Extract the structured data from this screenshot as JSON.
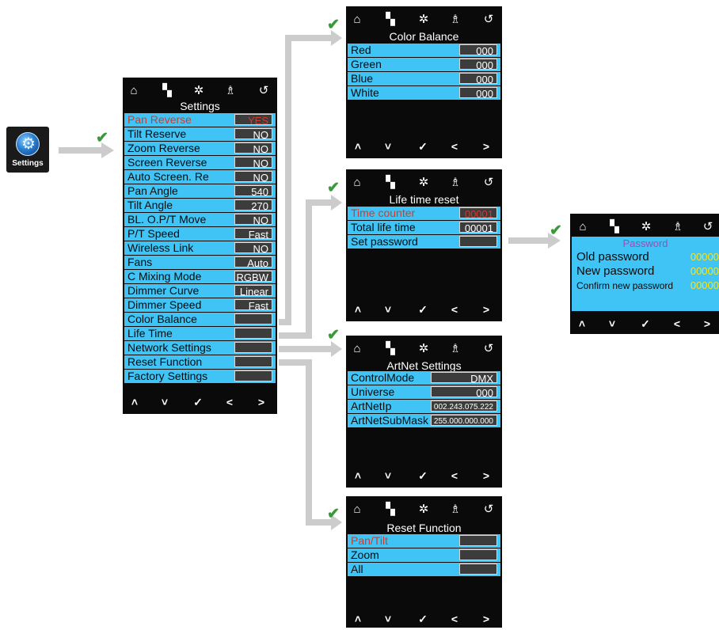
{
  "app_icon": {
    "label": "Settings",
    "icon": "gear-icon"
  },
  "nav_icons": {
    "home": "⌂",
    "mode": "▚",
    "effect": "✲",
    "network": "♗",
    "back": "↺"
  },
  "bottom_icons": {
    "up": "˄",
    "down": "˅",
    "ok": "✓",
    "left": "<",
    "right": ">"
  },
  "check_mark": "✔",
  "settings_panel": {
    "title": "Settings",
    "rows": [
      {
        "label": "Pan Reverse",
        "value": "YES",
        "selected": true
      },
      {
        "label": "Tilt Reserve",
        "value": "NO"
      },
      {
        "label": "Zoom Reverse",
        "value": "NO"
      },
      {
        "label": "Screen Reverse",
        "value": "NO"
      },
      {
        "label": "Auto Screen. Re",
        "value": "NO"
      },
      {
        "label": "Pan Angle",
        "value": "540"
      },
      {
        "label": "Tilt Angle",
        "value": "270"
      },
      {
        "label": "BL. O.P/T Move",
        "value": "NO"
      },
      {
        "label": "P/T Speed",
        "value": "Fast"
      },
      {
        "label": "Wireless Link",
        "value": "NO"
      },
      {
        "label": "Fans",
        "value": "Auto"
      },
      {
        "label": "C Mixing Mode",
        "value": "RGBW"
      },
      {
        "label": "Dimmer Curve",
        "value": "Linear"
      },
      {
        "label": "Dimmer Speed",
        "value": "Fast"
      },
      {
        "label": "Color Balance",
        "value": ""
      },
      {
        "label": "Life Time",
        "value": ""
      },
      {
        "label": "Network Settings",
        "value": ""
      },
      {
        "label": "Reset Function",
        "value": ""
      },
      {
        "label": "Factory Settings",
        "value": ""
      }
    ]
  },
  "color_balance_panel": {
    "title": "Color Balance",
    "rows": [
      {
        "label": "Red",
        "value": "000"
      },
      {
        "label": "Green",
        "value": "000"
      },
      {
        "label": "Blue",
        "value": "000"
      },
      {
        "label": "White",
        "value": "000"
      }
    ]
  },
  "life_time_panel": {
    "title": "Life time reset",
    "rows": [
      {
        "label": "Time counter",
        "value": "00001",
        "selected": true
      },
      {
        "label": "Total life time",
        "value": "00001"
      },
      {
        "label": "Set password",
        "value": ""
      }
    ]
  },
  "artnet_panel": {
    "title": "ArtNet Settings",
    "rows": [
      {
        "label": "ControlMode",
        "value": "DMX"
      },
      {
        "label": "Universe",
        "value": "000"
      },
      {
        "label": "ArtNetIp",
        "value": "002.243.075.222",
        "small": true
      },
      {
        "label": "ArtNetSubMask",
        "value": "255.000.000.000",
        "small": true
      }
    ]
  },
  "reset_panel": {
    "title": "Reset Function",
    "rows": [
      {
        "label": "Pan/Tilt",
        "value": "",
        "selected": true
      },
      {
        "label": "Zoom",
        "value": ""
      },
      {
        "label": "All",
        "value": ""
      }
    ]
  },
  "password_panel": {
    "title": "Password",
    "rows": [
      {
        "label": "Old password",
        "value": "00000"
      },
      {
        "label": "New password",
        "value": "00000"
      },
      {
        "label": "Confirm new password",
        "value": "00000"
      }
    ]
  },
  "colors": {
    "screen_bg": "#0a0a0a",
    "row_bg": "#40c4f5",
    "selected_text": "#d43a2a",
    "value_bg": "#3c3c3c",
    "password_title": "#a04bb5",
    "password_value": "#f4e520",
    "arrow": "#cccccc",
    "check": "#3a9a3a"
  }
}
